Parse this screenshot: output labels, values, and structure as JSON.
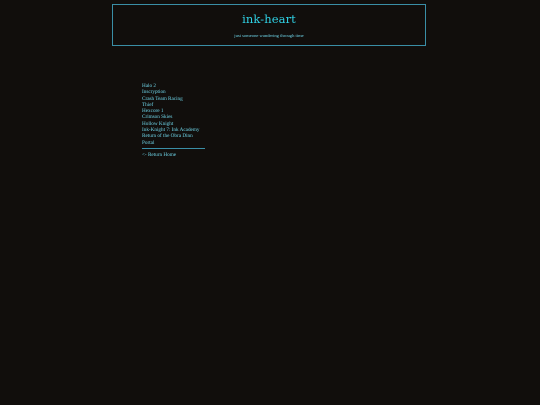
{
  "header": {
    "title": "ink-heart",
    "tagline": "just someone wandering through time"
  },
  "game_list": [
    "Halo 2",
    "Inscryption",
    "Crash Team Racing",
    "Thief",
    "Hexcore 1",
    "Crimson Skies",
    "Hollow Knight",
    "Ink-Knight 7: Ink Academy",
    "Return of the Obra Dinn",
    "Portal"
  ],
  "nav": {
    "return_home": "<- Return Home"
  },
  "colors": {
    "background": "#110e0c",
    "accent": "#2fd2e6",
    "link": "#6fd6ea",
    "border": "#3a8ea6"
  }
}
